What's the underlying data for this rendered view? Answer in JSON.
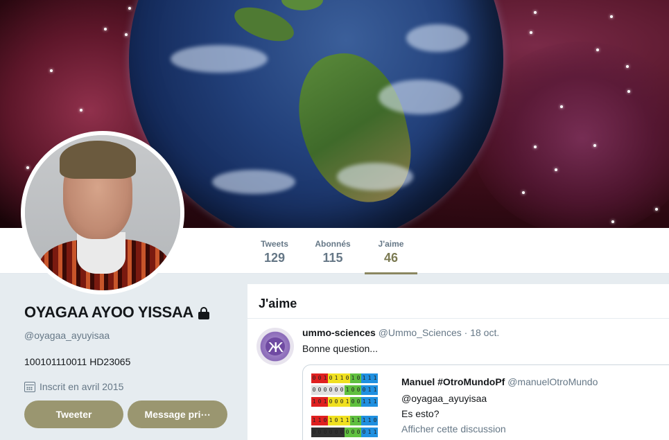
{
  "stats": [
    {
      "label": "Tweets",
      "value": "129"
    },
    {
      "label": "Abonnés",
      "value": "115"
    },
    {
      "label": "J'aime",
      "value": "46"
    }
  ],
  "profile": {
    "name": "OYAGAA AYOO YISSAA",
    "handle": "@oyagaa_ayuyisaa",
    "bio": "100101110011 HD23065",
    "joined": "Inscrit en avril 2015"
  },
  "actions": {
    "tweet_label": "Tweeter",
    "message_label": "Message pri⋯"
  },
  "timeline": {
    "title": "J'aime",
    "tweet": {
      "author": "ummo-sciences",
      "handle": "@Ummo_Sciences",
      "date": "· 18 oct.",
      "text": "Bonne question...",
      "quote": {
        "author": "Manuel #OtroMundoPf",
        "handle": "@manuelOtroMundo",
        "line1": "@oyagaa_ayuyisaa",
        "line2": "Es esto?",
        "link": "Afficher cette discussion"
      }
    }
  },
  "colors": {
    "accent": "#9a9670",
    "active_stat": "#7b7a52"
  },
  "quote_image": {
    "rows": [
      {
        "bits": [
          "0",
          "0",
          "1",
          "0",
          "1",
          "1",
          "0",
          "1",
          "0",
          "1",
          "1",
          "1"
        ],
        "colors": [
          "#e02020",
          "#e02020",
          "#e02020",
          "#f0e020",
          "#f0e020",
          "#f0e020",
          "#f0e020",
          "#60c040",
          "#60c040",
          "#2090e0",
          "#2090e0",
          "#2090e0"
        ]
      },
      {
        "bits": [
          "0",
          "0",
          "0",
          "0",
          "0",
          "0",
          "1",
          "0",
          "0",
          "0",
          "1",
          "1"
        ],
        "colors": [
          "#e0e0e0",
          "#e0e0e0",
          "#e0e0e0",
          "#e0e0e0",
          "#e0e0e0",
          "#e0e0e0",
          "#60c040",
          "#60c040",
          "#60c040",
          "#2090e0",
          "#2090e0",
          "#2090e0"
        ]
      },
      {
        "bits": [
          "1",
          "0",
          "1",
          "0",
          "0",
          "0",
          "1",
          "0",
          "0",
          "1",
          "1",
          "1"
        ],
        "colors": [
          "#e02020",
          "#e02020",
          "#e02020",
          "#f0e020",
          "#f0e020",
          "#f0e020",
          "#f0e020",
          "#60c040",
          "#60c040",
          "#2090e0",
          "#2090e0",
          "#2090e0"
        ]
      },
      {
        "bits": [],
        "colors": []
      },
      {
        "bits": [
          "1",
          "1",
          "0",
          "1",
          "0",
          "1",
          "1",
          "1",
          "1",
          "1",
          "1",
          "0"
        ],
        "colors": [
          "#e02020",
          "#e02020",
          "#e02020",
          "#f0e020",
          "#f0e020",
          "#f0e020",
          "#f0e020",
          "#60c040",
          "#60c040",
          "#2090e0",
          "#2090e0",
          "#2090e0"
        ]
      },
      {
        "bits": [
          "0",
          "0",
          "0",
          "0",
          "0",
          "0",
          "0",
          "0",
          "0",
          "0",
          "1",
          "1"
        ],
        "colors": [
          "#303030",
          "#303030",
          "#303030",
          "#303030",
          "#303030",
          "#303030",
          "#60c040",
          "#60c040",
          "#60c040",
          "#2090e0",
          "#2090e0",
          "#2090e0"
        ]
      }
    ]
  }
}
